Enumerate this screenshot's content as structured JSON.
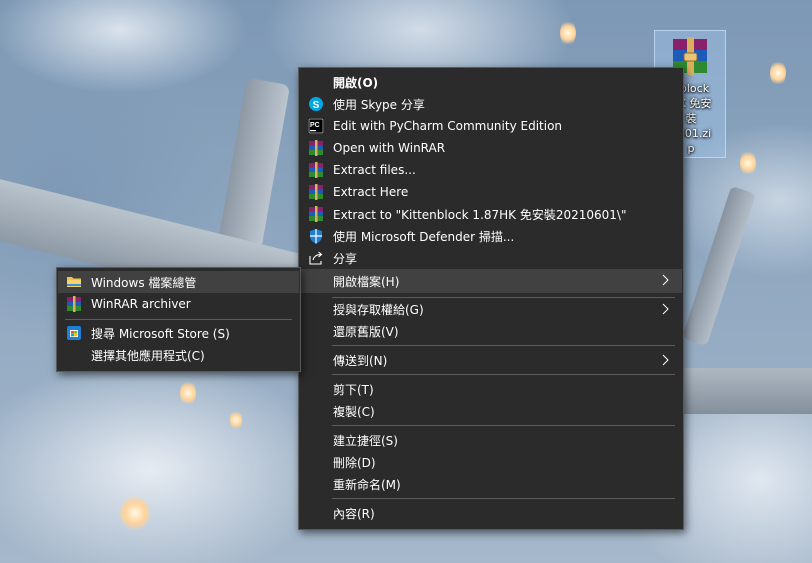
{
  "desktop": {
    "file_icon_label": "Kittenblock 1.87HK 免安裝20210601.zip",
    "file_icon_label_visible": "nblock\nHK 免安\n裝\n0601.zi\np"
  },
  "main_menu": {
    "items": [
      {
        "label": "開啟(O)",
        "icon": "none",
        "bold": true
      },
      {
        "label": "使用 Skype 分享",
        "icon": "skype-icon"
      },
      {
        "label": "Edit with PyCharm Community Edition",
        "icon": "pycharm-icon"
      },
      {
        "label": "Open with WinRAR",
        "icon": "winrar-icon"
      },
      {
        "label": "Extract files...",
        "icon": "winrar-icon"
      },
      {
        "label": "Extract Here",
        "icon": "winrar-icon"
      },
      {
        "label": "Extract to \"Kittenblock 1.87HK 免安裝20210601\\\"",
        "icon": "winrar-icon"
      },
      {
        "label": "使用 Microsoft Defender 掃描...",
        "icon": "defender-shield-icon"
      },
      {
        "label": "分享",
        "icon": "share-icon"
      },
      {
        "label": "開啟檔案(H)",
        "icon": "none",
        "submenu": true,
        "highlighted": true
      },
      {
        "label": "授與存取權給(G)",
        "icon": "none",
        "submenu": true
      },
      {
        "label": "還原舊版(V)",
        "icon": "none"
      },
      {
        "label": "傳送到(N)",
        "icon": "none",
        "submenu": true
      },
      {
        "label": "剪下(T)",
        "icon": "none"
      },
      {
        "label": "複製(C)",
        "icon": "none"
      },
      {
        "label": "建立捷徑(S)",
        "icon": "none"
      },
      {
        "label": "刪除(D)",
        "icon": "none"
      },
      {
        "label": "重新命名(M)",
        "icon": "none"
      },
      {
        "label": "內容(R)",
        "icon": "none"
      }
    ]
  },
  "open_with_submenu": {
    "items": [
      {
        "label": "Windows 檔案總管",
        "icon": "file-explorer-folder-icon",
        "highlighted": true
      },
      {
        "label": "WinRAR archiver",
        "icon": "winrar-icon"
      },
      {
        "label": "搜尋 Microsoft Store (S)",
        "icon": "microsoft-store-icon"
      },
      {
        "label": "選擇其他應用程式(C)",
        "icon": "none"
      }
    ]
  },
  "colors": {
    "menu_bg": "#2b2b2b",
    "menu_hover": "#414141",
    "separator": "#5c5c5c",
    "text": "#ffffff",
    "icon_selection": "#a0c4e8"
  }
}
